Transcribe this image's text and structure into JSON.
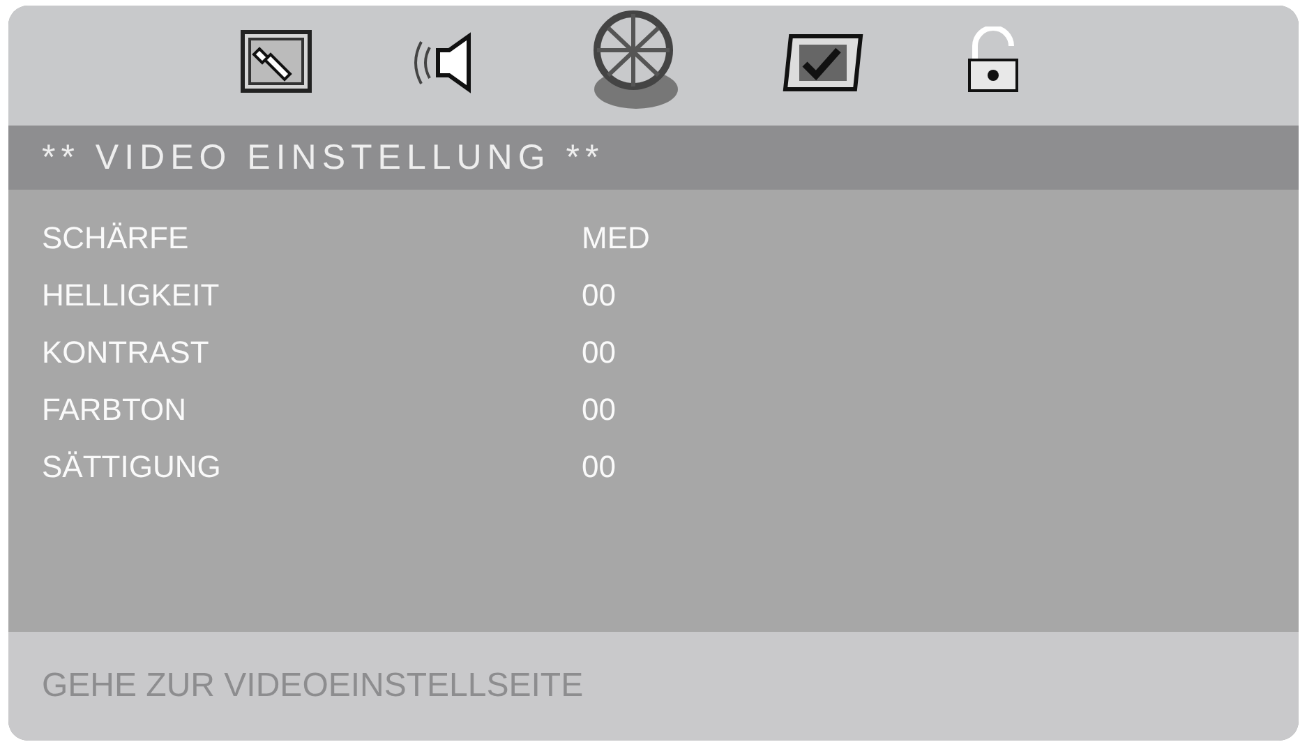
{
  "tabs": [
    {
      "kind": "setup",
      "selected": false
    },
    {
      "kind": "audio",
      "selected": false
    },
    {
      "kind": "video",
      "selected": true
    },
    {
      "kind": "preference",
      "selected": false
    },
    {
      "kind": "password",
      "selected": false
    }
  ],
  "title": "** VIDEO EINSTELLUNG **",
  "settings": [
    {
      "label": "SCHÄRFE",
      "value": "MED"
    },
    {
      "label": "HELLIGKEIT",
      "value": "00"
    },
    {
      "label": "KONTRAST",
      "value": "00"
    },
    {
      "label": "FARBTON",
      "value": "00"
    },
    {
      "label": "SÄTTIGUNG",
      "value": "00"
    }
  ],
  "status": "GEHE ZUR VIDEOEINSTELLSEITE"
}
